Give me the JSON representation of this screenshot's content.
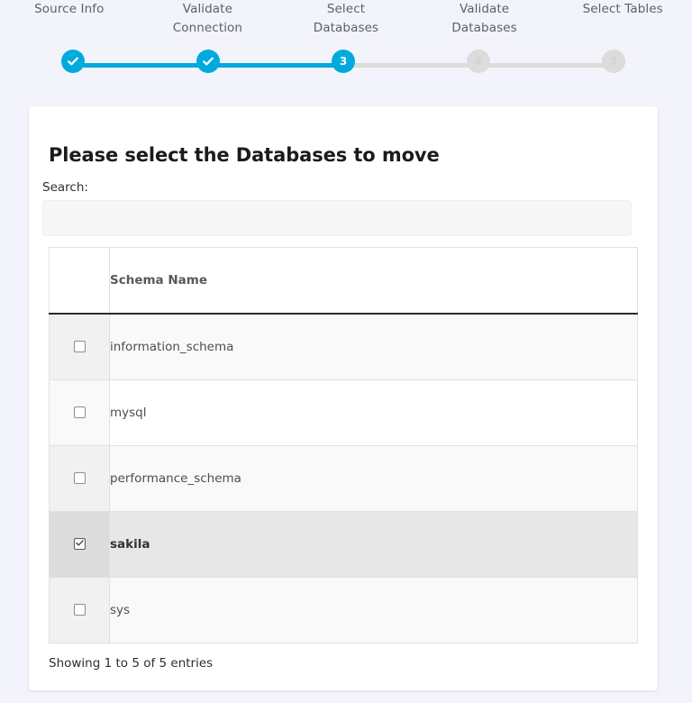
{
  "stepper": {
    "steps": [
      {
        "label": "Source Info",
        "state": "done",
        "marker": "check"
      },
      {
        "label": "Validate Connection",
        "state": "done",
        "marker": "check"
      },
      {
        "label": "Select Databases",
        "state": "active",
        "marker": "3"
      },
      {
        "label": "Validate Databases",
        "state": "todo",
        "marker": "4"
      },
      {
        "label": "Select Tables",
        "state": "todo",
        "marker": "5"
      }
    ],
    "colors": {
      "active": "#00aadd",
      "inactive": "#dcdcdc",
      "label": "#5a5f6e",
      "page_background": "#f3f3fb"
    }
  },
  "card": {
    "title": "Please select the Databases to move",
    "search": {
      "label": "Search:",
      "value": "",
      "placeholder": ""
    },
    "table": {
      "columns": [
        "",
        "Schema Name"
      ],
      "rows": [
        {
          "name": "information_schema",
          "checked": false,
          "selected": false
        },
        {
          "name": "mysql",
          "checked": false,
          "selected": false
        },
        {
          "name": "performance_schema",
          "checked": false,
          "selected": false
        },
        {
          "name": "sakila",
          "checked": true,
          "selected": true
        },
        {
          "name": "sys",
          "checked": false,
          "selected": false
        }
      ]
    },
    "footer": "Showing 1 to 5 of 5 entries"
  }
}
